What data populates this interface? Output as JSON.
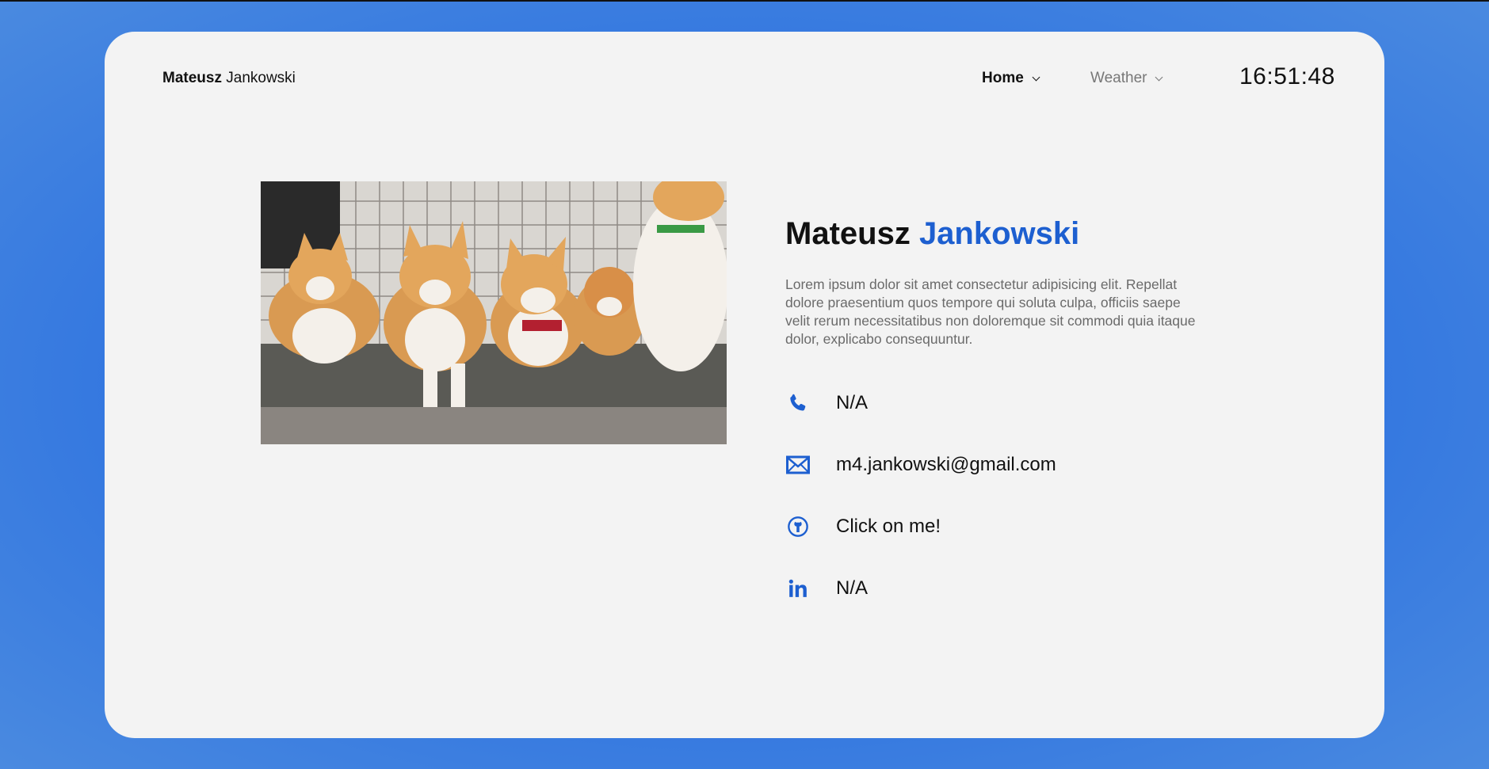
{
  "header": {
    "brand_first": "Mateusz",
    "brand_last": "Jankowski",
    "nav": {
      "home": "Home",
      "weather": "Weather"
    },
    "clock": "16:51:48"
  },
  "profile": {
    "first_name": "Mateusz",
    "last_name": "Jankowski",
    "description": "Lorem ipsum dolor sit amet consectetur adipisicing elit. Repellat dolore praesentium quos tempore qui soluta culpa, officiis saepe velit rerum necessitatibus non doloremque sit commodi quia itaque dolor, explicabo consequuntur.",
    "photo_alt": "corgi-dogs-photo"
  },
  "contacts": {
    "phone": {
      "icon": "phone-icon",
      "value": "N/A"
    },
    "email": {
      "icon": "mail-icon",
      "value": "m4.jankowski@gmail.com"
    },
    "github": {
      "icon": "github-icon",
      "value": "Click on me!"
    },
    "linkedin": {
      "icon": "linkedin-icon",
      "value": "N/A"
    }
  },
  "colors": {
    "accent": "#1d5fd0",
    "card_bg": "#f3f3f3",
    "page_bg": "#2a6fe0"
  }
}
